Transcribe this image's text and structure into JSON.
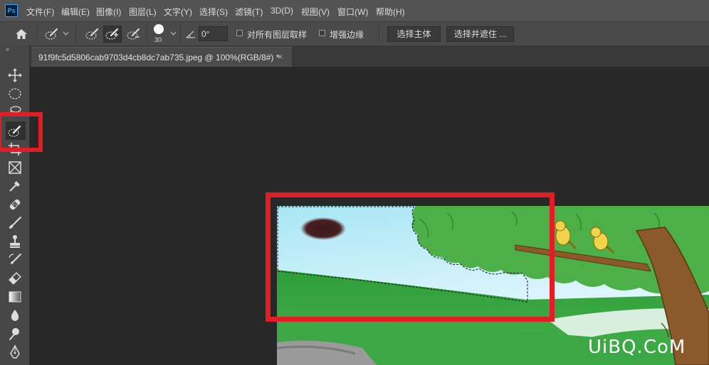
{
  "app": {
    "logo": "Ps"
  },
  "menu": {
    "items": [
      "文件(F)",
      "编辑(E)",
      "图像(I)",
      "图层(L)",
      "文字(Y)",
      "选择(S)",
      "滤镜(T)",
      "3D(D)",
      "视图(V)",
      "窗口(W)",
      "帮助(H)"
    ]
  },
  "options": {
    "brush_size": "30",
    "angle_value": "0°",
    "sample_all_layers_label": "对所有图层取样",
    "sample_all_layers_checked": false,
    "enhance_edge_label": "增强边缘",
    "enhance_edge_checked": false,
    "select_subject_label": "选择主体",
    "select_and_mask_label": "选择并遮住 ..."
  },
  "document": {
    "tab_title": "91f9fc5d5806cab9703d4cb8dc7ab735.jpeg @ 100%(RGB/8#) *",
    "close_glyph": "×"
  },
  "toolbar": {
    "collapse_glyph": "››",
    "tools": [
      "move-tool",
      "elliptical-marquee-tool",
      "lasso-tool",
      "quick-selection-tool",
      "crop-tool",
      "frame-tool",
      "eyedropper-tool",
      "healing-brush-tool",
      "brush-tool",
      "clone-stamp-tool",
      "history-brush-tool",
      "eraser-tool",
      "gradient-tool",
      "blur-tool",
      "dodge-tool",
      "pen-tool"
    ]
  },
  "colors": {
    "highlight": "#e21d25",
    "menubar": "#535353",
    "optbar": "#4a4a4a",
    "workspace": "#282828"
  },
  "watermark": "UiBQ.CoM"
}
